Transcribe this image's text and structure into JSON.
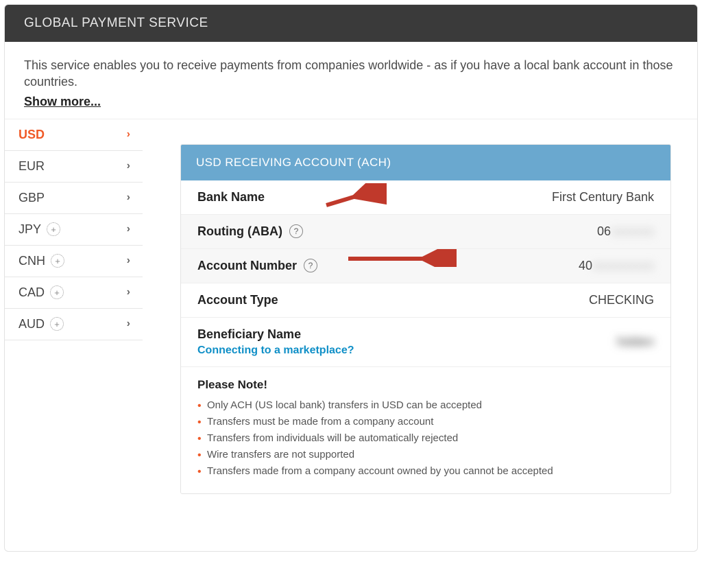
{
  "header": {
    "title": "GLOBAL PAYMENT SERVICE"
  },
  "intro": {
    "text": "This service enables you to receive payments from companies worldwide - as if you have a local bank account in those countries.",
    "show_more": "Show more..."
  },
  "sidebar": {
    "items": [
      {
        "code": "USD",
        "has_plus": false,
        "active": true
      },
      {
        "code": "EUR",
        "has_plus": false,
        "active": false
      },
      {
        "code": "GBP",
        "has_plus": false,
        "active": false
      },
      {
        "code": "JPY",
        "has_plus": true,
        "active": false
      },
      {
        "code": "CNH",
        "has_plus": true,
        "active": false
      },
      {
        "code": "CAD",
        "has_plus": true,
        "active": false
      },
      {
        "code": "AUD",
        "has_plus": true,
        "active": false
      }
    ]
  },
  "card": {
    "title": "USD RECEIVING ACCOUNT (ACH)",
    "rows": {
      "bank_name": {
        "label": "Bank Name",
        "value": "First Century Bank",
        "help": false,
        "blurred": false
      },
      "routing": {
        "label": "Routing (ABA)",
        "value_visible": "06",
        "value_hidden": "xxxxxxx",
        "help": true
      },
      "account_number": {
        "label": "Account Number",
        "value_visible": "40",
        "value_hidden": "xxxxxxxxxx",
        "help": true
      },
      "account_type": {
        "label": "Account Type",
        "value": "CHECKING",
        "help": false
      },
      "beneficiary": {
        "label": "Beneficiary Name",
        "link": "Connecting to a marketplace?",
        "value_hidden": "hidden"
      }
    },
    "note": {
      "title": "Please Note!",
      "items": [
        "Only ACH (US local bank) transfers in USD can be accepted",
        "Transfers must be made from a company account",
        "Transfers from individuals will be automatically rejected",
        "Wire transfers are not supported",
        "Transfers made from a company account owned by you cannot be accepted"
      ]
    }
  }
}
